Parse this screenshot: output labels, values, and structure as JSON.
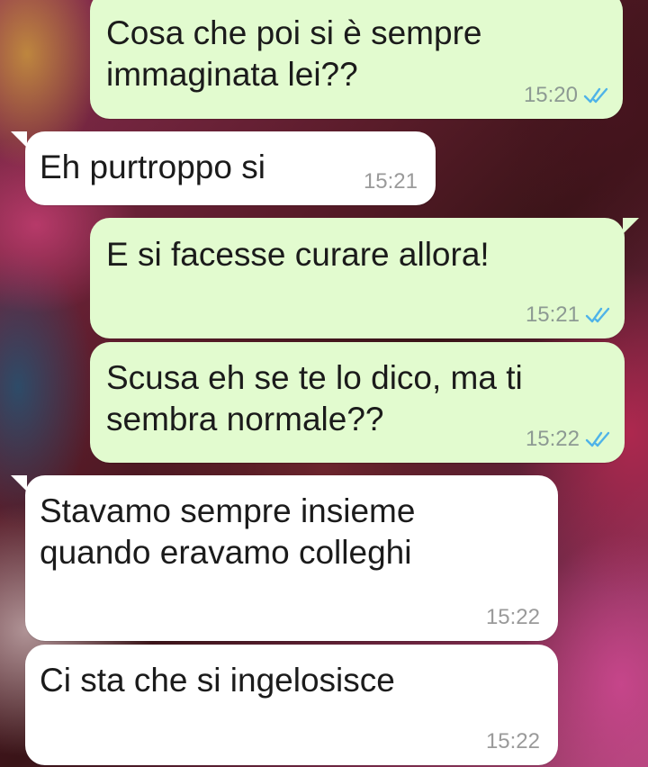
{
  "messages": [
    {
      "direction": "outgoing",
      "text": "Cosa che poi si è sempre\nimmaginata lei??",
      "time": "15:20",
      "status": "read",
      "status_icon": "double-check-icon"
    },
    {
      "direction": "incoming",
      "text": "Eh purtroppo si",
      "time": "15:21"
    },
    {
      "direction": "outgoing",
      "text": "E si facesse curare allora!",
      "time": "15:21",
      "status": "read",
      "status_icon": "double-check-icon"
    },
    {
      "direction": "outgoing",
      "text": "Scusa eh se te lo dico, ma ti\nsembra normale??",
      "time": "15:22",
      "status": "read",
      "status_icon": "double-check-icon"
    },
    {
      "direction": "incoming",
      "text": "Stavamo sempre insieme\nquando eravamo colleghi",
      "time": "15:22"
    },
    {
      "direction": "incoming",
      "text": "Ci sta che si ingelosisce",
      "time": "15:22"
    }
  ],
  "colors": {
    "outgoing_bubble": "#e2fbcf",
    "incoming_bubble": "#ffffff",
    "read_tick": "#4fb3e8",
    "timestamp": "#8d9a93"
  }
}
